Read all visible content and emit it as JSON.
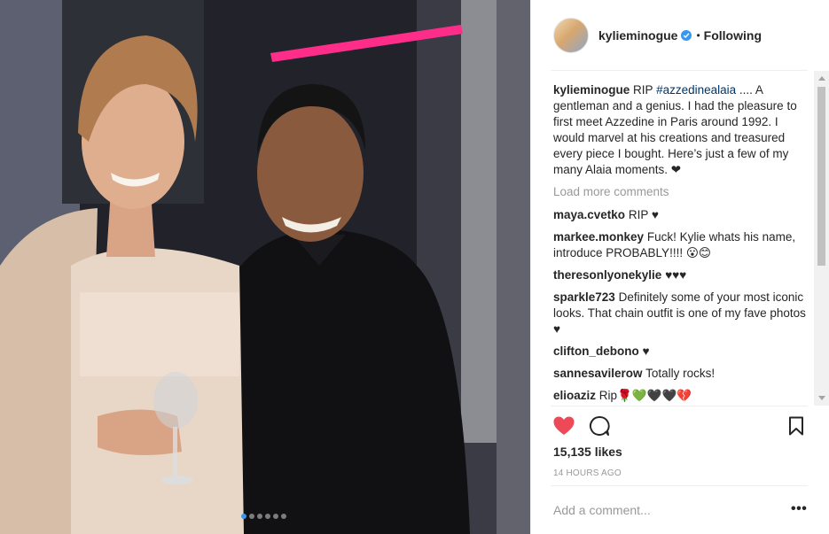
{
  "post": {
    "username": "kylieminogue",
    "follow_separator": "•",
    "follow_status": "Following",
    "caption_user": "kylieminogue",
    "caption_lead": "RIP",
    "caption_hashtag": "#azzedinealaia",
    "caption_text": ".... A gentleman and a genius. I had the pleasure to first meet Azzedine in Paris around 1992. I would marvel at his creations and treasured every piece I bought. Here’s just a few of my many Alaia moments. ❤",
    "load_more": "Load more comments",
    "comments": [
      {
        "user": "maya.cvetko",
        "text": "RIP ♥"
      },
      {
        "user": "markee.monkey",
        "text": "Fuck! Kylie whats his name, introduce PROBABLY!!!! 😮😊"
      },
      {
        "user": "theresonlyonekylie",
        "text": "♥♥♥"
      },
      {
        "user": "sparkle723",
        "text": "Definitely some of your most iconic looks. That chain outfit is one of my fave photos ♥"
      },
      {
        "user": "clifton_debono",
        "text": "♥"
      },
      {
        "user": "sannesavilerow",
        "text": "Totally rocks!"
      },
      {
        "user": "elioaziz",
        "text": "Rip🌹💚🖤🖤💔"
      }
    ],
    "likes": "15,135 likes",
    "time": "14 HOURS AGO",
    "add_comment_placeholder": "Add a comment...",
    "more_options": "•••",
    "carousel": {
      "count": 6,
      "active_index": 0
    }
  },
  "icons": {
    "verified": "verified-badge-icon",
    "like": "heart-icon",
    "comment": "comment-bubble-icon",
    "save": "bookmark-icon"
  },
  "colors": {
    "heart": "#ed4956",
    "verified": "#3897f0",
    "hashtag": "#003569",
    "muted": "#999999"
  }
}
